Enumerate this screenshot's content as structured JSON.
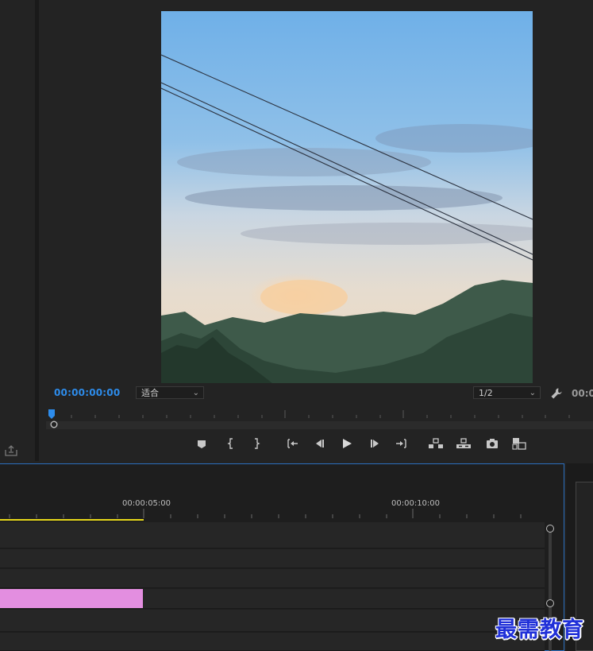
{
  "program_monitor": {
    "playhead_timecode": "00:00:00:00",
    "zoom_level": "适合",
    "playback_resolution": "1/2",
    "duration_timecode_partial": "00:0"
  },
  "transport": {
    "buttons": [
      {
        "name": "add-marker",
        "icon": "marker-icon"
      },
      {
        "name": "mark-in",
        "icon": "mark-in-icon"
      },
      {
        "name": "mark-out",
        "icon": "mark-out-icon"
      },
      {
        "name": "go-to-in",
        "icon": "go-to-in-icon"
      },
      {
        "name": "step-back",
        "icon": "step-back-icon"
      },
      {
        "name": "play",
        "icon": "play-icon"
      },
      {
        "name": "step-forward",
        "icon": "step-forward-icon"
      },
      {
        "name": "go-to-out",
        "icon": "go-to-out-icon"
      },
      {
        "name": "lift",
        "icon": "lift-icon"
      },
      {
        "name": "extract",
        "icon": "extract-icon"
      },
      {
        "name": "export-frame",
        "icon": "camera-icon"
      },
      {
        "name": "comparison-view",
        "icon": "compare-icon"
      }
    ]
  },
  "timeline": {
    "ruler_labels": [
      "00:00:05:00",
      "00:00:10:00"
    ],
    "clip_color": "#e38ee0",
    "work_area_color": "#e6d61a"
  },
  "colors": {
    "accent": "#2d8ceb",
    "panel_focus_border": "#2b6fbf",
    "background": "#232323"
  },
  "watermark": {
    "text": "最需教育"
  }
}
